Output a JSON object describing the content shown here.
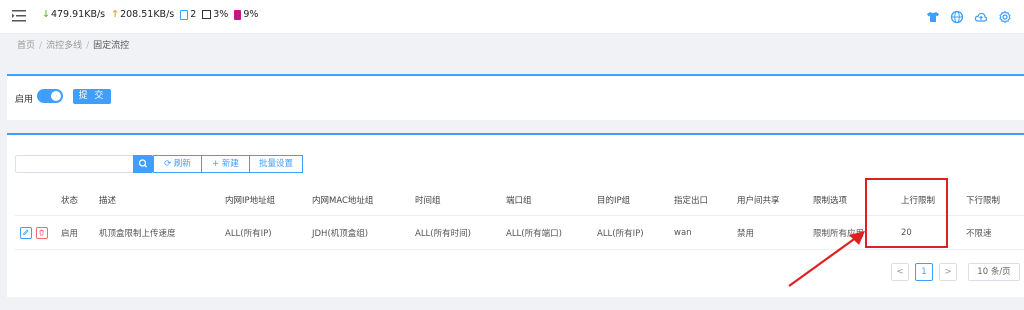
{
  "topbar": {
    "download_speed": "479.91KB/s",
    "upload_speed": "208.51KB/s",
    "device_count": "2",
    "cpu": "3%",
    "battery": "9%"
  },
  "breadcrumb": {
    "home": "首页",
    "parent": "流控多线",
    "current": "固定流控"
  },
  "enable_panel": {
    "label": "启用",
    "submit_label": "提 交"
  },
  "toolbar": {
    "refresh_label": "刷新",
    "new_label": "新建",
    "batch_label": "批量设置",
    "search_placeholder": ""
  },
  "table": {
    "headers": [
      "状态",
      "描述",
      "内网IP地址组",
      "内网MAC地址组",
      "时间组",
      "端口组",
      "目的IP组",
      "指定出口",
      "用户间共享",
      "限制选项",
      "上行限制",
      "下行限制"
    ],
    "rows": [
      [
        "启用",
        "机顶盒限制上传速度",
        "ALL(所有IP)",
        "JDH(机顶盒组)",
        "ALL(所有时间)",
        "ALL(所有端口)",
        "ALL(所有IP)",
        "wan",
        "禁用",
        "限制所有应用",
        "20",
        "不限速"
      ]
    ]
  },
  "pagination": {
    "prev": "<",
    "current_page": "1",
    "next": ">",
    "page_size": "10 条/页"
  },
  "colors": {
    "accent": "#409eff",
    "highlight": "#e02020"
  }
}
